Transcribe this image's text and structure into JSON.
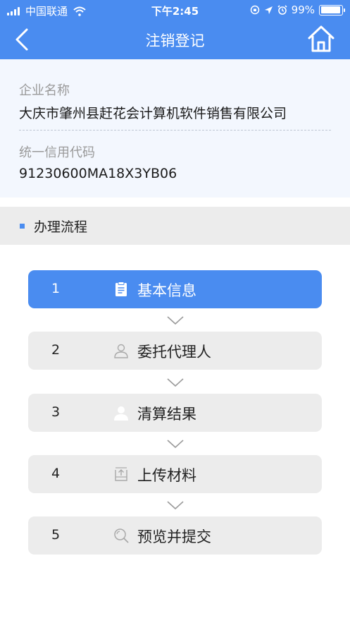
{
  "status_bar": {
    "carrier": "中国联通",
    "time": "下午2:45",
    "battery": "99%",
    "battery_level": 0.99
  },
  "nav": {
    "title": "注销登记",
    "back_icon": "chevron-left-icon",
    "home_icon": "home-icon"
  },
  "company": {
    "name_label": "企业名称",
    "name_value": "大庆市肇州县赶花会计算机软件销售有限公司",
    "code_label": "统一信用代码",
    "code_value": "91230600MA18X3YB06"
  },
  "section": {
    "title": "办理流程"
  },
  "steps": [
    {
      "num": "1",
      "label": "基本信息",
      "icon": "clipboard-icon",
      "active": true
    },
    {
      "num": "2",
      "label": "委托代理人",
      "icon": "person-outline-icon",
      "active": false
    },
    {
      "num": "3",
      "label": "清算结果",
      "icon": "person-filled-icon",
      "active": false
    },
    {
      "num": "4",
      "label": "上传材料",
      "icon": "upload-icon",
      "active": false
    },
    {
      "num": "5",
      "label": "预览并提交",
      "icon": "search-icon",
      "active": false
    }
  ],
  "colors": {
    "primary": "#4a8cf0",
    "card_bg": "#f3f7fe",
    "step_bg": "#ececec"
  }
}
